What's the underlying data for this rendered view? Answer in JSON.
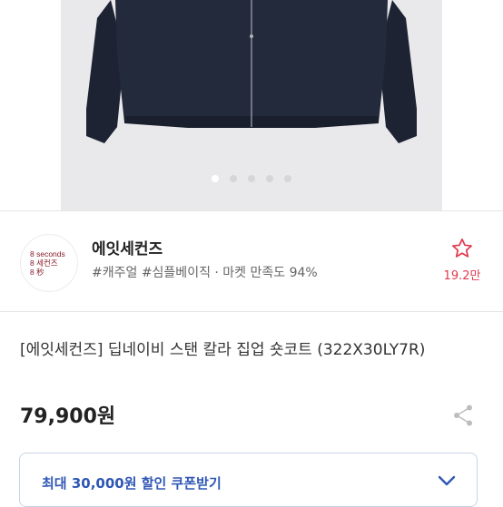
{
  "carousel": {
    "slide_count": 5,
    "active_index": 0
  },
  "store": {
    "logo_lines": [
      "8 seconds",
      "8 세컨즈",
      "8 秒"
    ],
    "name": "에잇세컨즈",
    "tags": "#캐주얼 #심플베이직 · 마켓 만족도 94%",
    "favorite_count": "19.2만"
  },
  "product": {
    "title": "[에잇세컨즈] 딥네이비 스탠 칼라 집업 숏코트 (322X30LY7R)",
    "price": "79,900원"
  },
  "coupon": {
    "label": "최대 30,000원 할인 쿠폰받기"
  },
  "colors": {
    "accent": "#2f57b5",
    "favorite": "#e03a4f",
    "garment": "#1d2333"
  },
  "icons": {
    "favorite": "star-icon",
    "share": "share-icon",
    "expand": "chevron-down-icon"
  }
}
